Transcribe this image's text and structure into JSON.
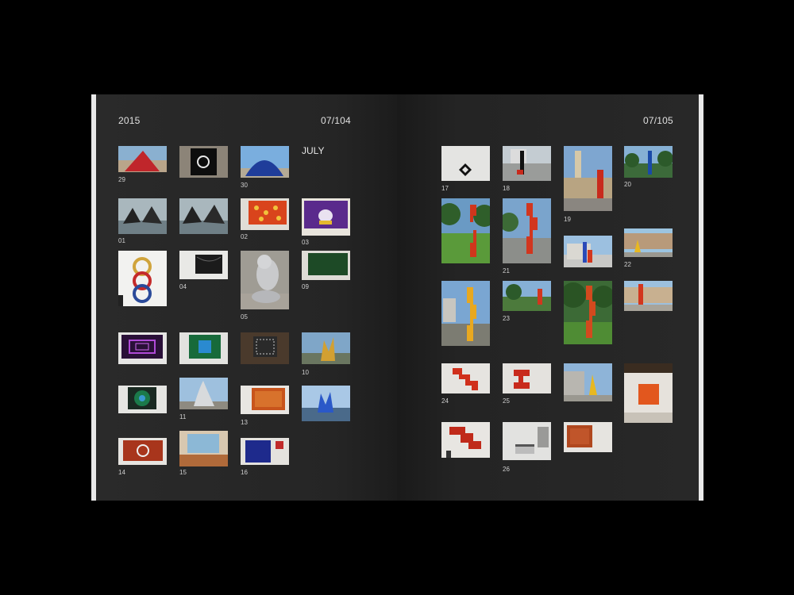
{
  "left_page": {
    "year": "2015",
    "page_number": "07/104",
    "month": "JULY"
  },
  "right_page": {
    "page_number": "07/105"
  },
  "left_captions": [
    "29",
    "30",
    "01",
    "02",
    "03",
    "04",
    "09",
    "05",
    "10",
    "11",
    "13",
    "14",
    "15",
    "16"
  ],
  "right_captions": [
    "17",
    "18",
    "19",
    "20",
    "21",
    "22",
    "23",
    "24",
    "25",
    "26"
  ]
}
